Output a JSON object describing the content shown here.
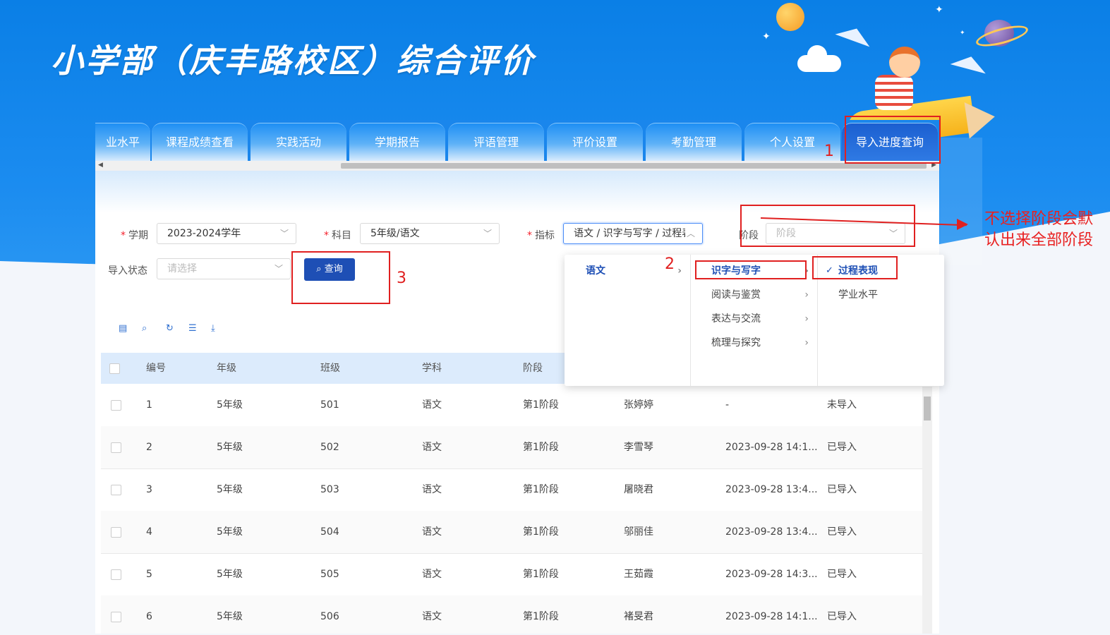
{
  "app": {
    "title": "小学部（庆丰路校区）综合评价"
  },
  "tabs": [
    {
      "label": "业水平"
    },
    {
      "label": "课程成绩查看"
    },
    {
      "label": "实践活动"
    },
    {
      "label": "学期报告"
    },
    {
      "label": "评语管理"
    },
    {
      "label": "评价设置"
    },
    {
      "label": "考勤管理"
    },
    {
      "label": "个人设置"
    },
    {
      "label": "导入进度查询",
      "active": true
    }
  ],
  "filters": {
    "term_label": "学期",
    "term_value": "2023-2024学年",
    "subject_label": "科目",
    "subject_value": "5年级/语文",
    "indicator_label": "指标",
    "indicator_value": "语文 / 识字与写字 / 过程表",
    "stage_label": "阶段",
    "stage_placeholder": "阶段",
    "status_label": "导入状态",
    "status_placeholder": "请选择",
    "query_button": "查询"
  },
  "cascader": {
    "col1": [
      "语文"
    ],
    "col2": [
      "识字与写字",
      "阅读与鉴赏",
      "表达与交流",
      "梳理与探究"
    ],
    "col3": [
      "过程表现",
      "学业水平"
    ]
  },
  "table": {
    "headers": [
      "编号",
      "年级",
      "班级",
      "学科",
      "阶段"
    ],
    "rows": [
      {
        "id": "1",
        "grade": "5年级",
        "class": "501",
        "subject": "语文",
        "stage": "第1阶段",
        "teacher": "张婷婷",
        "time": "-",
        "status": "未导入"
      },
      {
        "id": "2",
        "grade": "5年级",
        "class": "502",
        "subject": "语文",
        "stage": "第1阶段",
        "teacher": "李雪琴",
        "time": "2023-09-28 14:1...",
        "status": "已导入"
      },
      {
        "id": "3",
        "grade": "5年级",
        "class": "503",
        "subject": "语文",
        "stage": "第1阶段",
        "teacher": "屠晓君",
        "time": "2023-09-28 13:4...",
        "status": "已导入"
      },
      {
        "id": "4",
        "grade": "5年级",
        "class": "504",
        "subject": "语文",
        "stage": "第1阶段",
        "teacher": "邬丽佳",
        "time": "2023-09-28 13:4...",
        "status": "已导入"
      },
      {
        "id": "5",
        "grade": "5年级",
        "class": "505",
        "subject": "语文",
        "stage": "第1阶段",
        "teacher": "王茹霞",
        "time": "2023-09-28 14:3...",
        "status": "已导入"
      },
      {
        "id": "6",
        "grade": "5年级",
        "class": "506",
        "subject": "语文",
        "stage": "第1阶段",
        "teacher": "褚旻君",
        "time": "2023-09-28 14:1...",
        "status": "已导入"
      }
    ]
  },
  "annotations": {
    "n1": "1",
    "n2": "2",
    "n3": "3",
    "note": "不选择阶段会默认出来全部阶段",
    "color": "#e02020"
  },
  "colors": {
    "primary": "#1e4fb5",
    "header_bg": "#1a86ec",
    "table_head": "#dcebfc"
  }
}
